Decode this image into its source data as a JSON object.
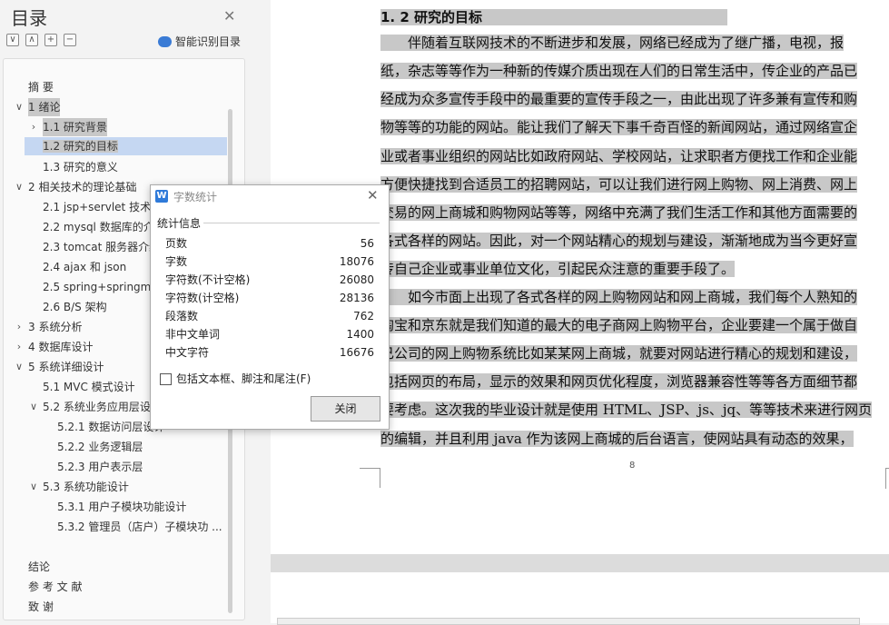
{
  "sidebar": {
    "title": "目录",
    "ai_label": "智能识别目录",
    "tools": [
      "∨",
      "∧",
      "+",
      "−"
    ],
    "items": [
      {
        "label": "摘    要"
      },
      {
        "label": "1  绪论"
      },
      {
        "label": "1.1  研究背景"
      },
      {
        "label": "1.2 研究的目标"
      },
      {
        "label": "1.3 研究的意义"
      },
      {
        "label": "2 相关技术的理论基础"
      },
      {
        "label": "2.1 jsp+servlet 技术优"
      },
      {
        "label": "2.2 mysql 数据库的介绍"
      },
      {
        "label": "2.3 tomcat 服务器介绍"
      },
      {
        "label": "2.4 ajax 和 json"
      },
      {
        "label": "2.5 spring+springmvc"
      },
      {
        "label": "2.6 B/S 架构"
      },
      {
        "label": "3  系统分析"
      },
      {
        "label": "4  数据库设计"
      },
      {
        "label": "5  系统详细设计"
      },
      {
        "label": "5.1 MVC 模式设计"
      },
      {
        "label": "5.2  系统业务应用层设"
      },
      {
        "label": "5.2.1  数据访问层设计"
      },
      {
        "label": "5.2.2 业务逻辑层"
      },
      {
        "label": "5.2.3 用户表示层"
      },
      {
        "label": "5.3  系统功能设计"
      },
      {
        "label": "5.3.1 用户子模块功能设计"
      },
      {
        "label": "5.3.2 管理员（店户）子模块功 ..."
      },
      {
        "label": "结论"
      },
      {
        "label": "参  考  文  献"
      },
      {
        "label": "致  谢"
      }
    ]
  },
  "document": {
    "lines": [
      "1. 2 研究的目标",
      "　　伴随着互联网技术的不断进步和发展，网络已经成为了继广播，电视，报",
      "纸，杂志等等作为一种新的传媒介质出现在人们的日常生活中，传企业的产品已",
      "经成为众多宣传手段中的最重要的宣传手段之一，由此出现了许多兼有宣传和购",
      "物等等的功能的网站。能让我们了解天下事千奇百怪的新闻网站，通过网络宣企",
      "业或者事业组织的网站比如政府网站、学校网站，让求职者方便找工作和企业能",
      "方便快捷找到合适员工的招聘网站，可以让我们进行网上购物、网上消费、网上",
      "交易的网上商城和购物网站等等，网络中充满了我们生活工作和其他方面需要的",
      "各式各样的网站。因此，对一个网站精心的规划与建设，渐渐地成为当今更好宣",
      "传自己企业或事业单位文化，引起民众注意的重要手段了。",
      "　　如今市面上出现了各式各样的网上购物网站和网上商城，我们每个人熟知的",
      "淘宝和京东就是我们知道的最大的电子商网上购物平台，企业要建一个属于做自",
      "己公司的网上购物系统比如某某网上商城，就要对网站进行精心的规划和建设，",
      "包括网页的布局，显示的效果和网页优化程度，浏览器兼容性等等各方面细节都",
      "要考虑。这次我的毕业设计就是使用 HTML、JSP、js、jq、等等技术来进行网页",
      "的编辑，并且利用 java 作为该网上商城的后台语言，使网站具有动态的效果，"
    ],
    "page_number": "8"
  },
  "dialog": {
    "icon": "W",
    "title": "字数统计",
    "section": "统计信息",
    "stats": [
      {
        "label": "页数",
        "value": "56"
      },
      {
        "label": "字数",
        "value": "18076"
      },
      {
        "label": "字符数(不计空格)",
        "value": "26080"
      },
      {
        "label": "字符数(计空格)",
        "value": "28136"
      },
      {
        "label": "段落数",
        "value": "762"
      },
      {
        "label": "非中文单词",
        "value": "1400"
      },
      {
        "label": "中文字符",
        "value": "16676"
      }
    ],
    "checkbox_label": "包括文本框、脚注和尾注(F)",
    "close_label": "关闭"
  }
}
